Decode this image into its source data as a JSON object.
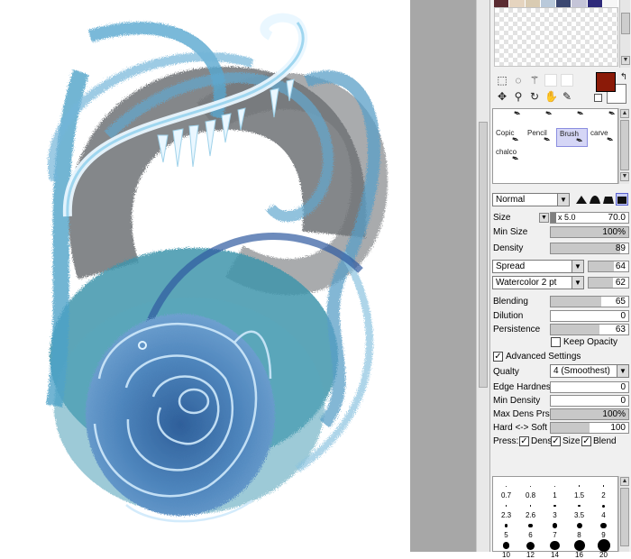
{
  "swatch_colors": [
    "#5a2b31",
    "#e5d4bf",
    "#d9cbb2",
    "#b9c9da",
    "#3b4770",
    "#c5c5d8",
    "#2e2a7a",
    "#f6f6f6"
  ],
  "colors": {
    "foreground": "#8b1a08",
    "background": "#ffffff",
    "selection": "#d5d6f6"
  },
  "brushes": [
    {
      "label": "",
      "selected": false
    },
    {
      "label": "",
      "selected": false
    },
    {
      "label": "",
      "selected": false
    },
    {
      "label": "",
      "selected": false
    },
    {
      "label": "Copic",
      "selected": false
    },
    {
      "label": "Pencil",
      "selected": false
    },
    {
      "label": "Brush",
      "selected": true
    },
    {
      "label": "carve",
      "selected": false
    },
    {
      "label": "chalco",
      "selected": false
    }
  ],
  "blend_mode": "Normal",
  "size": {
    "label": "Size",
    "multiplier": "x 5.0",
    "value": "70.0"
  },
  "min_size": {
    "label": "Min Size",
    "value": "100%"
  },
  "density": {
    "label": "Density",
    "value": "89"
  },
  "texture1": {
    "name": "Spread",
    "value": "64"
  },
  "texture2": {
    "name": "Watercolor 2 pt",
    "value": "62"
  },
  "blending": {
    "label": "Blending",
    "value": "65"
  },
  "dilution": {
    "label": "Dilution",
    "value": "0"
  },
  "persistence": {
    "label": "Persistence",
    "value": "63"
  },
  "keep_opacity": {
    "label": "Keep Opacity",
    "checked": false
  },
  "advanced": {
    "label": "Advanced Settings",
    "checked": true
  },
  "quality": {
    "label": "Qualty",
    "value": "4 (Smoothest)"
  },
  "edge_hardness": {
    "label": "Edge Hardness",
    "value": "0"
  },
  "min_density": {
    "label": "Min Density",
    "value": "0"
  },
  "max_dens_prs": {
    "label": "Max Dens Prs.",
    "value": "100%"
  },
  "hard_soft": {
    "label": "Hard <-> Soft",
    "value": "100"
  },
  "press": {
    "label": "Press:",
    "dens": "Dens",
    "size": "Size",
    "blend": "Blend"
  },
  "brush_sizes": [
    "0.7",
    "0.8",
    "1",
    "1.5",
    "2",
    "2.3",
    "2.6",
    "3",
    "3.5",
    "4",
    "5",
    "6",
    "7",
    "8",
    "9",
    "10",
    "12",
    "14",
    "16",
    "20"
  ]
}
